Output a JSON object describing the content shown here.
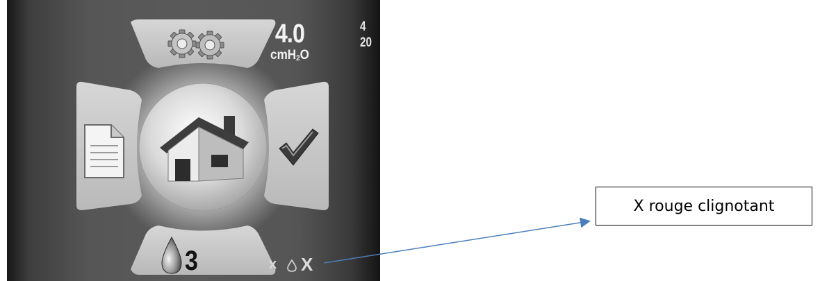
{
  "screen": {
    "pressure_value": "4.0",
    "pressure_unit_prefix": "cmH",
    "pressure_unit_sub": "2",
    "pressure_unit_suffix": "O",
    "side_value_top": "4",
    "side_value_bottom": "20",
    "humidifier_level": "3",
    "status_left": "x",
    "status_right": "X"
  },
  "icons": {
    "top": "gears-icon",
    "left": "document-icon",
    "center": "home-icon",
    "right": "checkmark-icon",
    "bottom": "water-drop-icon",
    "status": "small-water-drop-icon"
  },
  "annotation": {
    "callout_text": "X rouge clignotant"
  },
  "colors": {
    "screen_bg": "#555555",
    "panel": "#c8c8c8",
    "callout_arrow": "#4a7ebb",
    "blink_x": "#ff0000"
  }
}
